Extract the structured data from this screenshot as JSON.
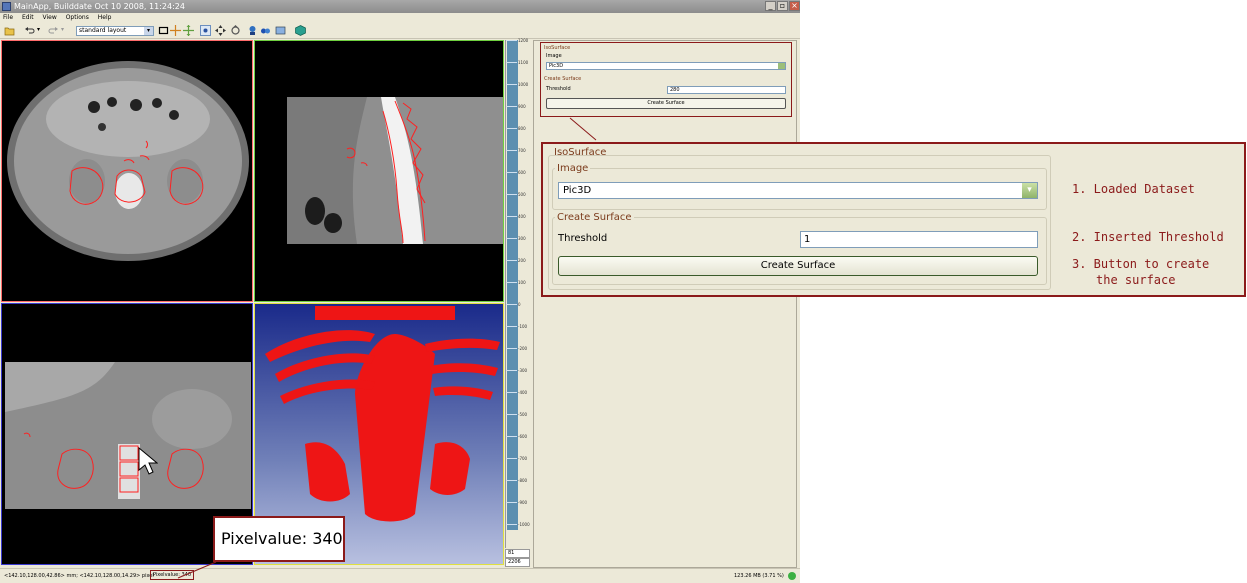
{
  "window": {
    "title": "MainApp, Builddate Oct 10 2008, 11:24:24",
    "menu": [
      "File",
      "Edit",
      "View",
      "Options",
      "Help"
    ],
    "layout_select": "standard layout"
  },
  "ruler": {
    "ticks": [
      "1200",
      "1100",
      "1000",
      "900",
      "800",
      "700",
      "600",
      "500",
      "400",
      "300",
      "200",
      "100",
      "0",
      "-100",
      "-200",
      "-300",
      "-400",
      "-500",
      "-600",
      "-700",
      "-800",
      "-900",
      "-1000"
    ],
    "level": "81",
    "window": "2206"
  },
  "small_panel": {
    "title": "IsoSurface",
    "image_group": "Image",
    "image_value": "Pic3D",
    "create_group": "Create Surface",
    "threshold_label": "Threshold",
    "threshold_value": "280",
    "button": "Create Surface"
  },
  "big_panel": {
    "title": "IsoSurface",
    "image_group": "Image",
    "image_value": "Pic3D",
    "create_group": "Create Surface",
    "threshold_label": "Threshold",
    "threshold_value": "1",
    "button": "Create Surface"
  },
  "callouts": {
    "c1": "1. Loaded Dataset",
    "c2": "2. Inserted Threshold",
    "c3a": "3. Button to create",
    "c3b": "the surface"
  },
  "statusbar": {
    "coords": "<142.10,128.00,42.86> mm; <142.10,128.00,14.29> pixel",
    "pixelvalue": "Pixelvalue: 340",
    "memory": "123.26 MB (3.71 %)"
  },
  "pixel_callout": "Pixelvalue: 340",
  "colors": {
    "accent": "#8b1a1a",
    "contour": "#ff2020",
    "view_axial_border": "#ff6a6a",
    "view_sagittal_border": "#6fcf3f",
    "view_coronal_border": "#3a3ad0",
    "view_3d_border": "#e0e040"
  }
}
